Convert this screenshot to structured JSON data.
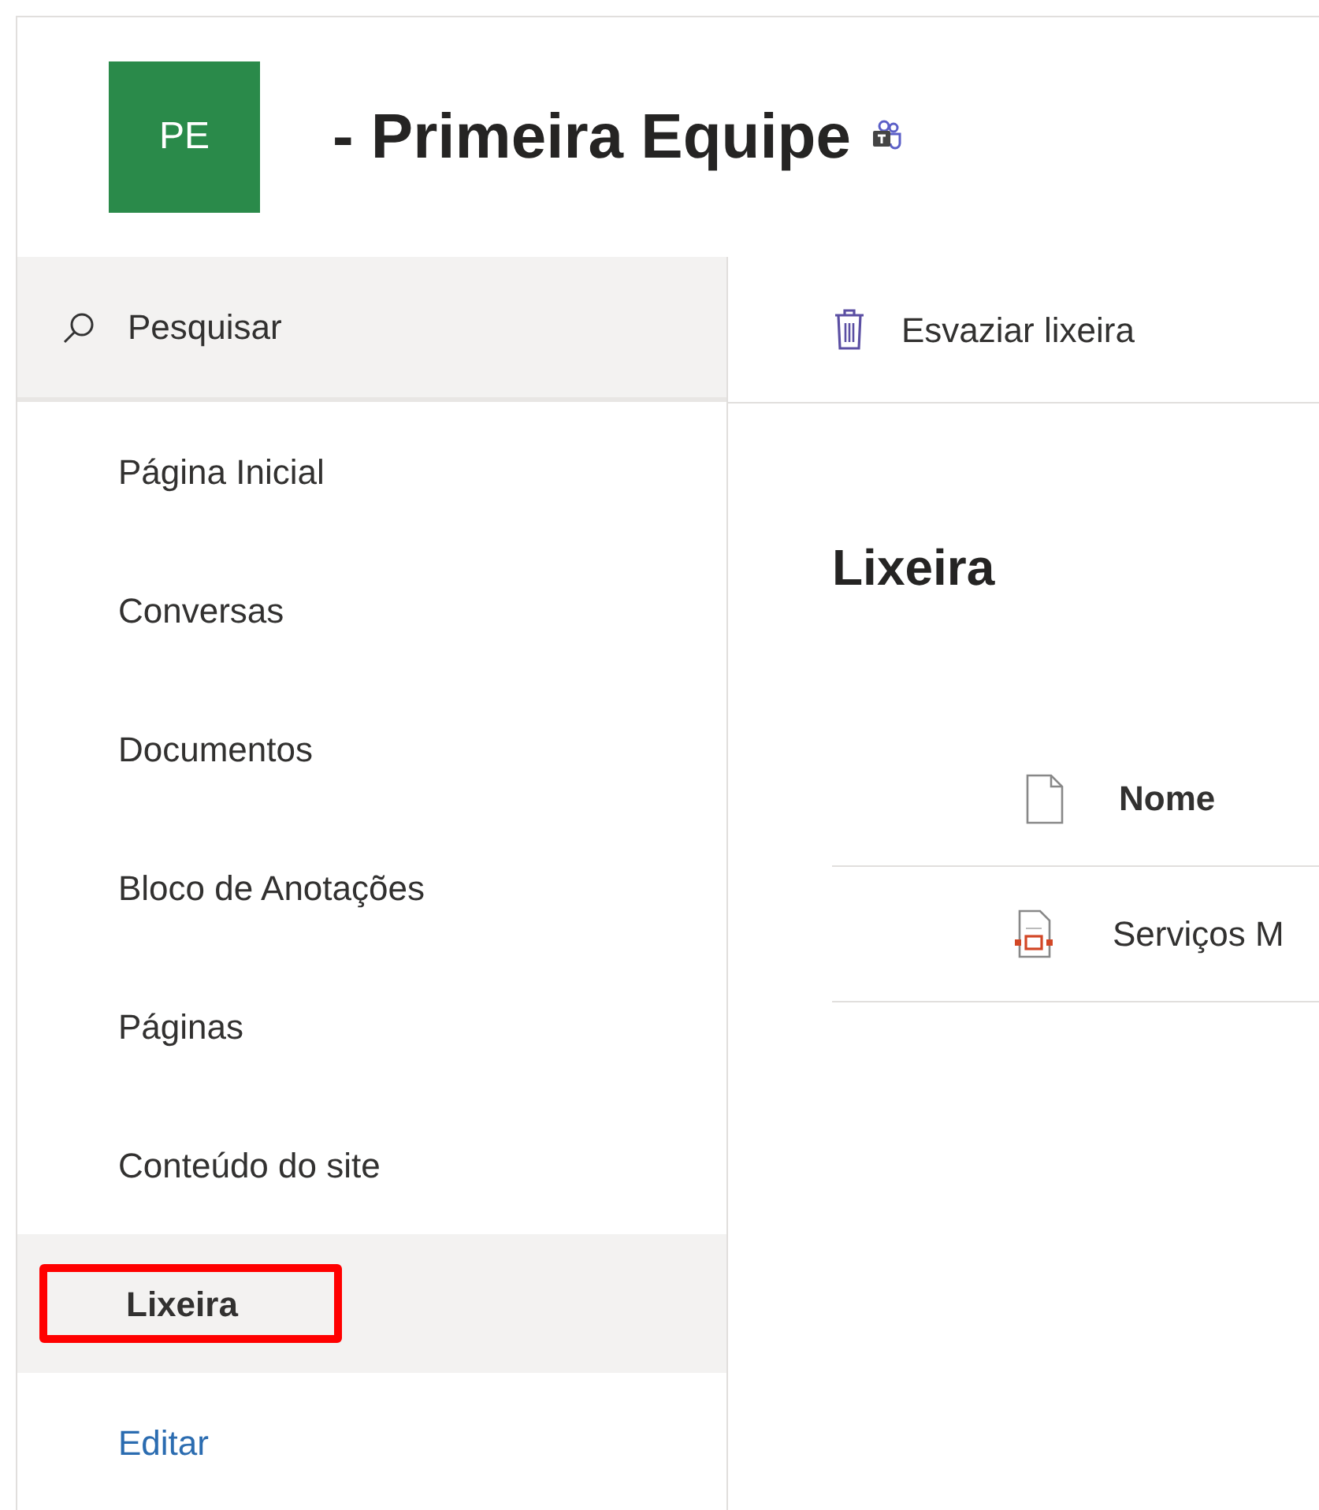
{
  "site": {
    "logo_initials": "PE",
    "title": "- Primeira Equipe"
  },
  "search": {
    "placeholder": "Pesquisar"
  },
  "nav": [
    {
      "label": "Página Inicial",
      "selected": false,
      "highlighted": false,
      "kind": "item"
    },
    {
      "label": "Conversas",
      "selected": false,
      "highlighted": false,
      "kind": "item"
    },
    {
      "label": "Documentos",
      "selected": false,
      "highlighted": false,
      "kind": "item"
    },
    {
      "label": "Bloco de Anotações",
      "selected": false,
      "highlighted": false,
      "kind": "item"
    },
    {
      "label": "Páginas",
      "selected": false,
      "highlighted": false,
      "kind": "item"
    },
    {
      "label": "Conteúdo do site",
      "selected": false,
      "highlighted": false,
      "kind": "item"
    },
    {
      "label": "Lixeira",
      "selected": true,
      "highlighted": true,
      "kind": "item"
    },
    {
      "label": "Editar",
      "selected": false,
      "highlighted": false,
      "kind": "link"
    }
  ],
  "command_bar": {
    "empty_button": "Esvaziar lixeira"
  },
  "page_title": "Lixeira",
  "table": {
    "columns": [
      "Nome"
    ],
    "rows": [
      {
        "name": "Serviços M"
      }
    ]
  }
}
